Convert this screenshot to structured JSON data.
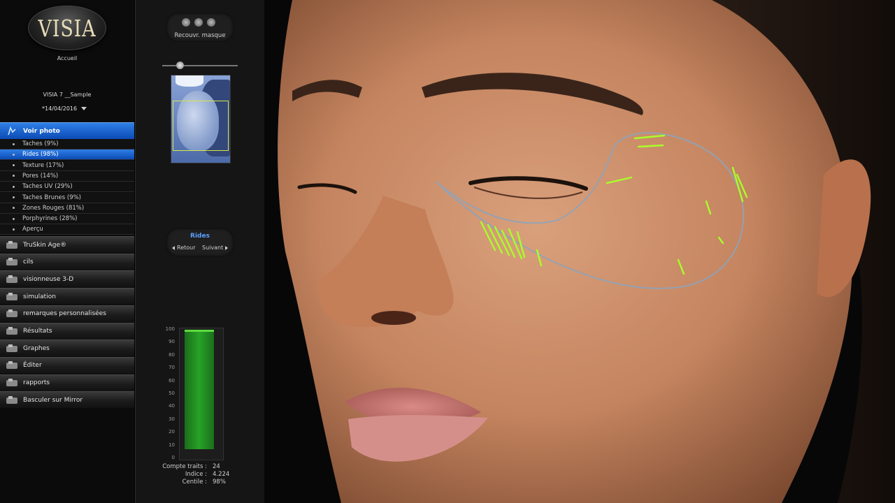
{
  "app": {
    "logo_text": "VISIA",
    "home_label": "Accueil"
  },
  "patient": {
    "name": "VISIA 7 __Sample",
    "session_date": "*14/04/2016"
  },
  "sidebar": {
    "view_photo": {
      "label": "Voir photo",
      "icon": "camera-icon"
    },
    "sub_items": [
      {
        "label": "Taches (9%)",
        "active": false
      },
      {
        "label": "Rides (98%)",
        "active": true
      },
      {
        "label": "Texture (17%)",
        "active": false
      },
      {
        "label": "Pores (14%)",
        "active": false
      },
      {
        "label": "Taches UV (29%)",
        "active": false
      },
      {
        "label": "Taches Brunes (9%)",
        "active": false
      },
      {
        "label": "Zones Rouges (81%)",
        "active": false
      },
      {
        "label": "Porphyrines  (28%)",
        "active": false
      },
      {
        "label": "Aperçu",
        "active": false
      }
    ],
    "items": [
      {
        "label": "TruSkin Age®",
        "icon": "truskin-age-icon"
      },
      {
        "label": "cils",
        "icon": "eyelash-icon"
      },
      {
        "label": "visionneuse 3-D",
        "icon": "3d-viewer-icon"
      },
      {
        "label": "simulation",
        "icon": "simulation-icon"
      },
      {
        "label": "remarques personnalisées",
        "icon": "notes-icon"
      },
      {
        "label": "Résultats",
        "icon": "results-icon"
      },
      {
        "label": "Graphes",
        "icon": "graphs-icon"
      },
      {
        "label": "Éditer",
        "icon": "edit-icon"
      },
      {
        "label": "rapports",
        "icon": "reports-icon"
      },
      {
        "label": "Basculer sur Mirror",
        "icon": "mirror-icon"
      }
    ]
  },
  "panel": {
    "mask_label": "Recouvr. masque",
    "mask_opacity": 0.2,
    "nav": {
      "title": "Rides",
      "prev": "Retour",
      "next": "Suivant"
    },
    "gauge": {
      "value_percent": 98,
      "ticks": [
        "100",
        "90",
        "80",
        "70",
        "60",
        "50",
        "40",
        "30",
        "20",
        "10",
        "0"
      ]
    },
    "stats": [
      {
        "key": "Compte traits :",
        "value": "24"
      },
      {
        "key": "Indice :",
        "value": "4.224"
      },
      {
        "key": "Centile :",
        "value": "98%"
      }
    ]
  },
  "colors": {
    "accent": "#1f66d4",
    "wrinkle_mark": "#a8ff2a",
    "roi_outline": "#8fa3b8"
  }
}
